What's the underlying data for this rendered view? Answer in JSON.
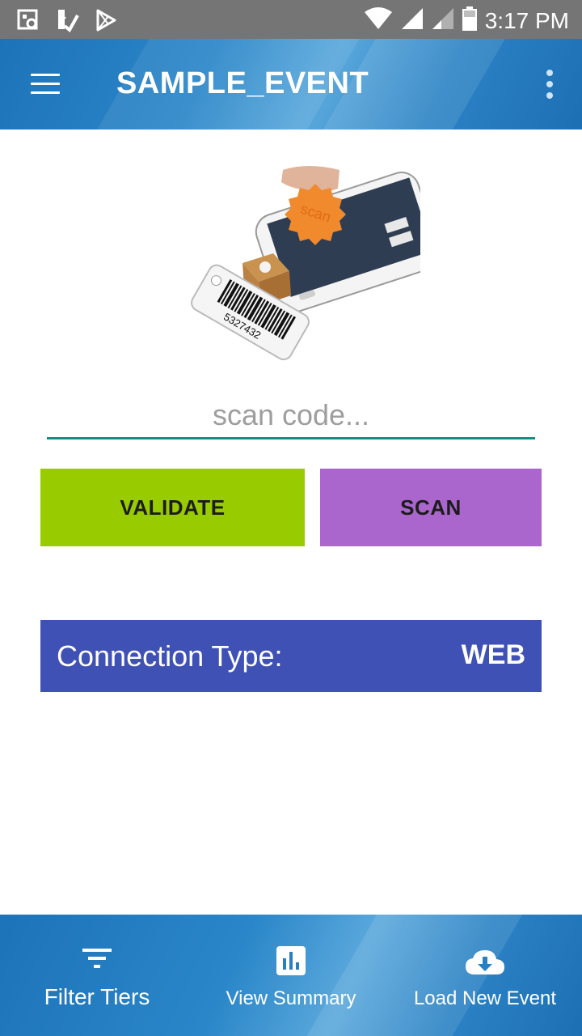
{
  "status_bar": {
    "time": "3:17 PM",
    "left_icons": [
      "screenshot-icon",
      "tasks-icon",
      "play-store-icon"
    ],
    "right_icons": [
      "wifi-icon",
      "signal-icon",
      "signal-weak-icon",
      "battery-icon"
    ]
  },
  "app_bar": {
    "title": "SAMPLE_EVENT",
    "menu_icon": "hamburger-menu-icon",
    "overflow_icon": "more-vert-icon"
  },
  "hero": {
    "tag_number": "5327432",
    "seal_text": "scan"
  },
  "scan_input": {
    "value": "",
    "placeholder": "scan code..."
  },
  "buttons": {
    "validate": "VALIDATE",
    "scan": "SCAN"
  },
  "connection": {
    "label": "Connection Type:",
    "value": "WEB"
  },
  "bottom_nav": [
    {
      "label": "Filter Tiers",
      "icon": "filter-icon"
    },
    {
      "label": "View Summary",
      "icon": "bar-chart-icon"
    },
    {
      "label": "Load New Event",
      "icon": "cloud-download-icon"
    }
  ],
  "colors": {
    "validate": "#99cc00",
    "scan": "#aa66cc",
    "connection": "#3f51b5",
    "underline": "#168e86",
    "bar": "#1e73b8",
    "status_bar": "#757575"
  }
}
